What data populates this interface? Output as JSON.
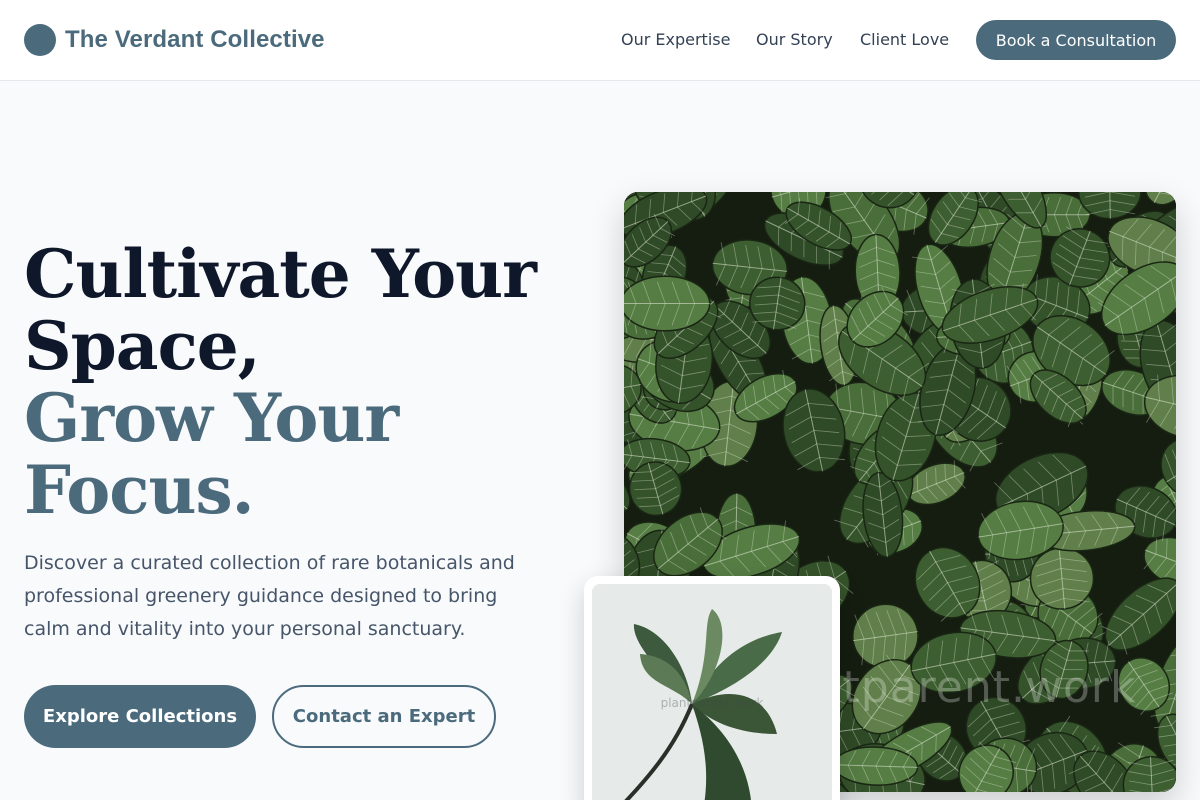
{
  "header": {
    "brand": "The Verdant Collective",
    "nav": {
      "expertise": "Our Expertise",
      "story": "Our Story",
      "love": "Client Love"
    },
    "cta": "Book a Consultation"
  },
  "hero": {
    "headline": {
      "line1": "Cultivate Your",
      "line2": "Space,",
      "line3": "Grow Your",
      "line4": "Focus."
    },
    "lead": "Discover a curated collection of rare botanicals and professional greenery guidance designed to bring calm and vitality into your personal sanctuary.",
    "primary_button": "Explore Collections",
    "secondary_button": "Contact an Expert"
  },
  "images": {
    "main_watermark": "plantparent.work",
    "inset_watermark": "plantparent.work",
    "main_alt": "Nerve plant leaves close-up",
    "inset_alt": "Single leafy plant stem"
  },
  "colors": {
    "accent": "#4b6b7d",
    "heading": "#0f172a",
    "body_text": "#475569",
    "page_background": "#f8fafc"
  },
  "icons": {
    "logo": "logo-circle-icon"
  }
}
